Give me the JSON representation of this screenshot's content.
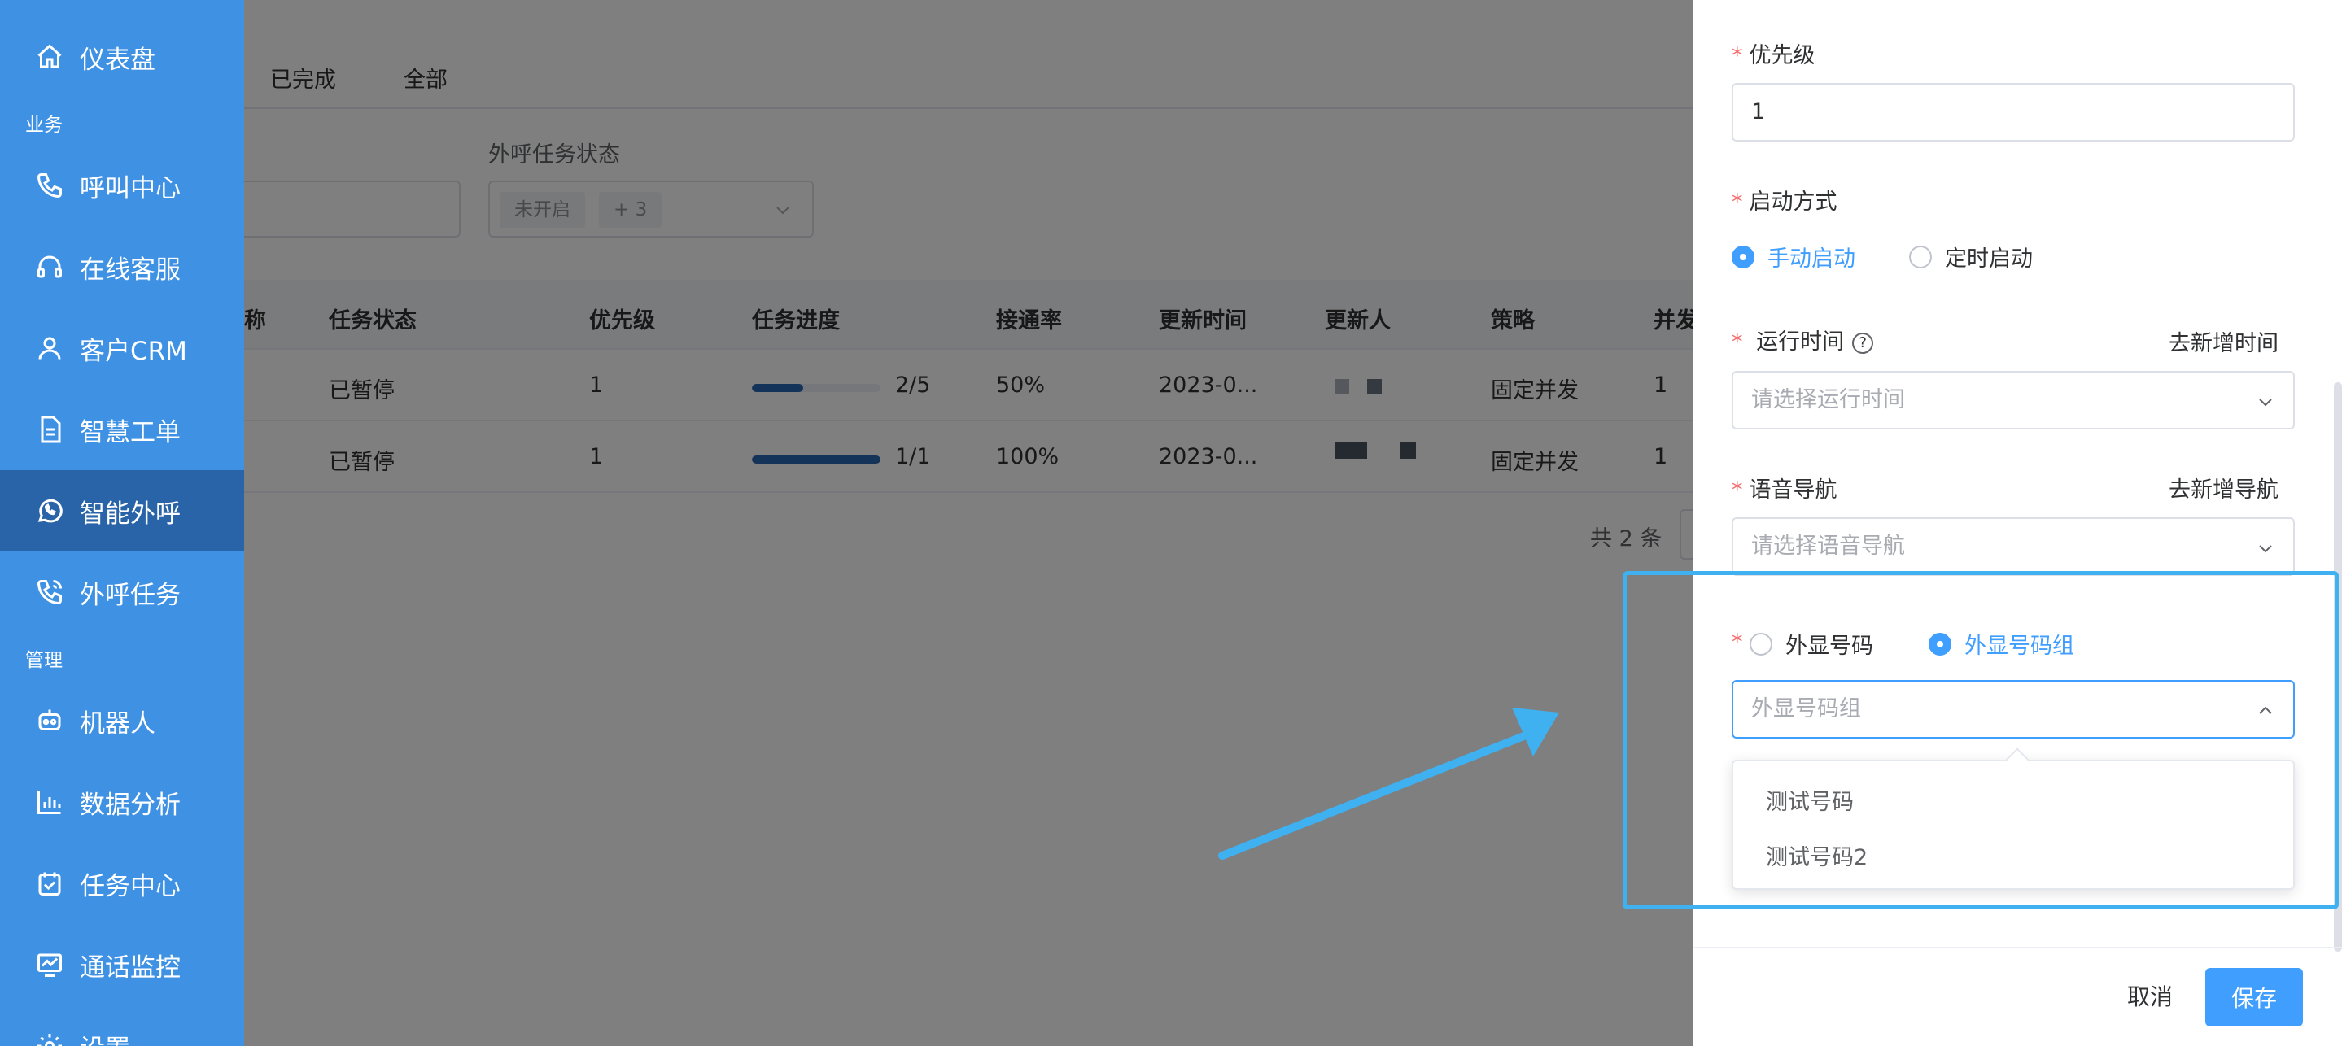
{
  "sidebar": {
    "items": [
      {
        "label": "仪表盘",
        "icon": "home-icon"
      },
      {
        "label": "呼叫中心",
        "icon": "phone-icon"
      },
      {
        "label": "在线客服",
        "icon": "headset-icon"
      },
      {
        "label": "客户CRM",
        "icon": "user-icon"
      },
      {
        "label": "智慧工单",
        "icon": "document-icon"
      },
      {
        "label": "智能外呼",
        "icon": "whatsapp-phone-icon",
        "active": true
      },
      {
        "label": "外呼任务",
        "icon": "outbound-call-icon"
      },
      {
        "label": "机器人",
        "icon": "robot-icon"
      },
      {
        "label": "数据分析",
        "icon": "bar-chart-icon"
      },
      {
        "label": "任务中心",
        "icon": "calendar-check-icon"
      },
      {
        "label": "通话监控",
        "icon": "monitor-chart-icon"
      },
      {
        "label": "设置",
        "icon": "settings-icon"
      }
    ],
    "groups": {
      "business": "业务",
      "management": "管理"
    }
  },
  "main": {
    "tabs": [
      "已完成",
      "全部"
    ],
    "filter": {
      "status_label": "外呼任务状态",
      "status_tag": "未开启",
      "status_more": "+ 3"
    },
    "table": {
      "name_col_tail": "称",
      "columns": [
        "任务状态",
        "优先级",
        "任务进度",
        "接通率",
        "更新时间",
        "更新人",
        "策略",
        "并发"
      ],
      "rows": [
        {
          "status": "已暂停",
          "priority": "1",
          "progress": 0.4,
          "progress_text": "2/5",
          "rate": "50%",
          "updated": "2023-0...",
          "strategy": "固定并发",
          "concurrency": "1"
        },
        {
          "status": "已暂停",
          "priority": "1",
          "progress": 1.0,
          "progress_text": "1/1",
          "rate": "100%",
          "updated": "2023-0...",
          "strategy": "固定并发",
          "concurrency": "1"
        }
      ]
    },
    "pager_total": "共 2 条"
  },
  "drawer": {
    "priority": {
      "label": "优先级",
      "value": "1"
    },
    "start_mode": {
      "label": "启动方式",
      "options": [
        "手动启动",
        "定时启动"
      ],
      "selected": 0
    },
    "run_time": {
      "label": "运行时间",
      "help": "?",
      "link": "去新增时间",
      "placeholder": "请选择运行时间"
    },
    "voice_nav": {
      "label": "语音导航",
      "link": "去新增导航",
      "placeholder": "请选择语音导航"
    },
    "caller": {
      "options": [
        "外显号码",
        "外显号码组"
      ],
      "selected": 1,
      "placeholder": "外显号码组",
      "dropdown": [
        "测试号码",
        "测试号码2"
      ]
    },
    "buttons": {
      "cancel": "取消",
      "save": "保存"
    }
  },
  "colors": {
    "sidebar": "#3f91e4",
    "sidebar_active": "#2a64a8",
    "primary": "#409eff",
    "annotation": "#3fb0f0"
  }
}
